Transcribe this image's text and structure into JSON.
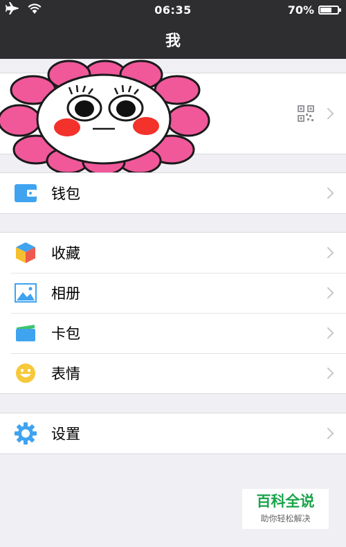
{
  "status": {
    "time": "06:35",
    "battery": "70%",
    "battery_level": 0.7
  },
  "nav": {
    "title": "我"
  },
  "profile": {
    "avatar_icon": "flower-sticker"
  },
  "wallet": {
    "label": "钱包",
    "icon": "wallet-icon"
  },
  "menu": [
    {
      "label": "收藏",
      "icon": "favorites-cube-icon"
    },
    {
      "label": "相册",
      "icon": "album-photo-icon"
    },
    {
      "label": "卡包",
      "icon": "card-pack-icon"
    },
    {
      "label": "表情",
      "icon": "emoji-smile-icon"
    }
  ],
  "settings": {
    "label": "设置",
    "icon": "settings-gear-icon"
  },
  "watermark": {
    "title": "百科全说",
    "subtitle": "助你轻松解决"
  },
  "colors": {
    "nav_bg": "#2e2e31",
    "page_bg": "#efeff4",
    "accent_blue": "#3fa3f0",
    "watermark_green": "#1aa34a"
  }
}
